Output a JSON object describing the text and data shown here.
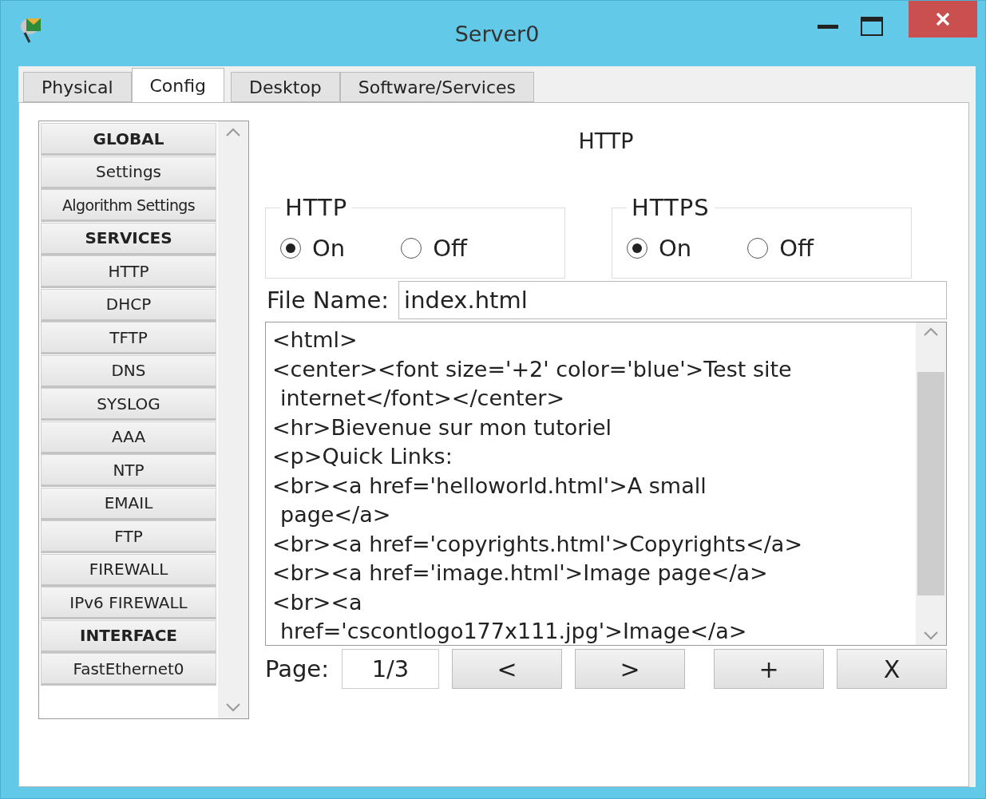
{
  "window": {
    "title": "Server0"
  },
  "tabs": [
    {
      "label": "Physical",
      "selected": false
    },
    {
      "label": "Config",
      "selected": true
    },
    {
      "label": "Desktop",
      "selected": false
    },
    {
      "label": "Software/Services",
      "selected": false
    }
  ],
  "sidebar": {
    "items": [
      {
        "label": "GLOBAL",
        "kind": "header"
      },
      {
        "label": "Settings",
        "kind": "item"
      },
      {
        "label": "Algorithm Settings",
        "kind": "item"
      },
      {
        "label": "SERVICES",
        "kind": "header"
      },
      {
        "label": "HTTP",
        "kind": "item"
      },
      {
        "label": "DHCP",
        "kind": "item"
      },
      {
        "label": "TFTP",
        "kind": "item"
      },
      {
        "label": "DNS",
        "kind": "item"
      },
      {
        "label": "SYSLOG",
        "kind": "item"
      },
      {
        "label": "AAA",
        "kind": "item"
      },
      {
        "label": "NTP",
        "kind": "item"
      },
      {
        "label": "EMAIL",
        "kind": "item"
      },
      {
        "label": "FTP",
        "kind": "item"
      },
      {
        "label": "FIREWALL",
        "kind": "item"
      },
      {
        "label": "IPv6 FIREWALL",
        "kind": "item"
      },
      {
        "label": "INTERFACE",
        "kind": "header"
      },
      {
        "label": "FastEthernet0",
        "kind": "item"
      }
    ]
  },
  "panel": {
    "title": "HTTP",
    "groups": [
      {
        "title": "HTTP",
        "options": [
          {
            "label": "On",
            "selected": true
          },
          {
            "label": "Off",
            "selected": false
          }
        ]
      },
      {
        "title": "HTTPS",
        "options": [
          {
            "label": "On",
            "selected": true
          },
          {
            "label": "Off",
            "selected": false
          }
        ]
      }
    ],
    "file_name": {
      "label": "File Name:",
      "value": "index.html"
    },
    "editor": {
      "lines": [
        {
          "text": "<html>",
          "kind": "line"
        },
        {
          "text": "<center><font size='+2' color='blue'>Test site",
          "kind": "line"
        },
        {
          "text": "internet</font></center>",
          "kind": "wrap"
        },
        {
          "text": "<hr>Bievenue sur mon tutoriel",
          "kind": "line"
        },
        {
          "text": "<p>Quick Links:",
          "kind": "line"
        },
        {
          "text": "<br><a href='helloworld.html'>A small",
          "kind": "line"
        },
        {
          "text": "page</a>",
          "kind": "wrap"
        },
        {
          "text": "<br><a href='copyrights.html'>Copyrights</a>",
          "kind": "line"
        },
        {
          "text": "<br><a href='image.html'>Image page</a>",
          "kind": "line"
        },
        {
          "text": "<br><a",
          "kind": "line"
        },
        {
          "text": "href='cscontlogo177x111.jpg'>Image</a>",
          "kind": "wrap"
        }
      ]
    },
    "pager": {
      "label": "Page:",
      "value": "1/3",
      "buttons": [
        "<",
        ">",
        "+",
        "X"
      ]
    }
  }
}
